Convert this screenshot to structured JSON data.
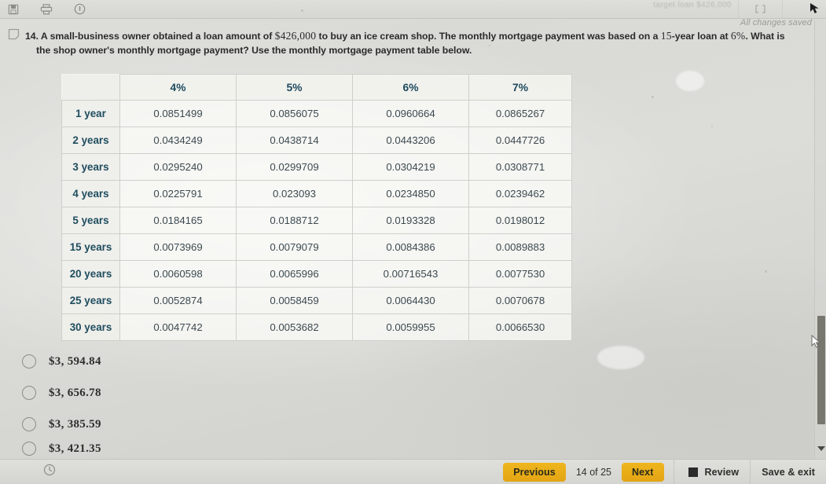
{
  "toolbar": {
    "icons": [
      {
        "name": "save-icon",
        "label": "Save"
      },
      {
        "name": "print-icon",
        "label": "Print"
      },
      {
        "name": "info-icon",
        "label": "Info"
      }
    ],
    "ghost_text": "target loan $426,000",
    "saved_status": "All changes saved"
  },
  "question": {
    "flag_icon": "flag-bookmark-icon",
    "number": "14.",
    "line1_a": "A small-business owner obtained a loan amount of ",
    "loan_amount": "$426,000",
    "line1_b": " to buy an ice cream shop. The monthly mortgage payment was based on a ",
    "term": "15",
    "line1_c": "-year loan at ",
    "rate": "6%",
    "line1_d": ". What is",
    "line2": "the shop owner's monthly mortgage payment? Use the monthly mortgage payment table below."
  },
  "table": {
    "corner": "",
    "columns": [
      "4%",
      "5%",
      "6%",
      "7%"
    ],
    "rows": [
      {
        "label": "1 year",
        "values": [
          "0.0851499",
          "0.0856075",
          "0.0960664",
          "0.0865267"
        ]
      },
      {
        "label": "2 years",
        "values": [
          "0.0434249",
          "0.0438714",
          "0.0443206",
          "0.0447726"
        ]
      },
      {
        "label": "3 years",
        "values": [
          "0.0295240",
          "0.0299709",
          "0.0304219",
          "0.0308771"
        ]
      },
      {
        "label": "4 years",
        "values": [
          "0.0225791",
          "0.023093",
          "0.0234850",
          "0.0239462"
        ]
      },
      {
        "label": "5 years",
        "values": [
          "0.0184165",
          "0.0188712",
          "0.0193328",
          "0.0198012"
        ]
      },
      {
        "label": "15 years",
        "values": [
          "0.0073969",
          "0.0079079",
          "0.0084386",
          "0.0089883"
        ]
      },
      {
        "label": "20 years",
        "values": [
          "0.0060598",
          "0.0065996",
          "0.00716543",
          "0.0077530"
        ]
      },
      {
        "label": "25 years",
        "values": [
          "0.0052874",
          "0.0058459",
          "0.0064430",
          "0.0070678"
        ]
      },
      {
        "label": "30 years",
        "values": [
          "0.0047742",
          "0.0053682",
          "0.0059955",
          "0.0066530"
        ]
      }
    ]
  },
  "options": [
    {
      "label": "$3, 594.84",
      "selected": false
    },
    {
      "label": "$3, 656.78",
      "selected": false
    },
    {
      "label": "$3, 385.59",
      "selected": false
    },
    {
      "label": "$3, 421.35",
      "selected": false
    }
  ],
  "bottom_bar": {
    "clock_icon": "clock-icon",
    "previous_label": "Previous",
    "pager_label": "14 of 25",
    "next_label": "Next",
    "review_label": "Review",
    "review_checked": true,
    "save_exit_label": "Save & exit"
  },
  "colors": {
    "accent_amber": "#E3A413",
    "header_navy": "#1C4A5E",
    "page_bg": "#D8D8D4",
    "scrollbar_thumb": "#77776F"
  }
}
